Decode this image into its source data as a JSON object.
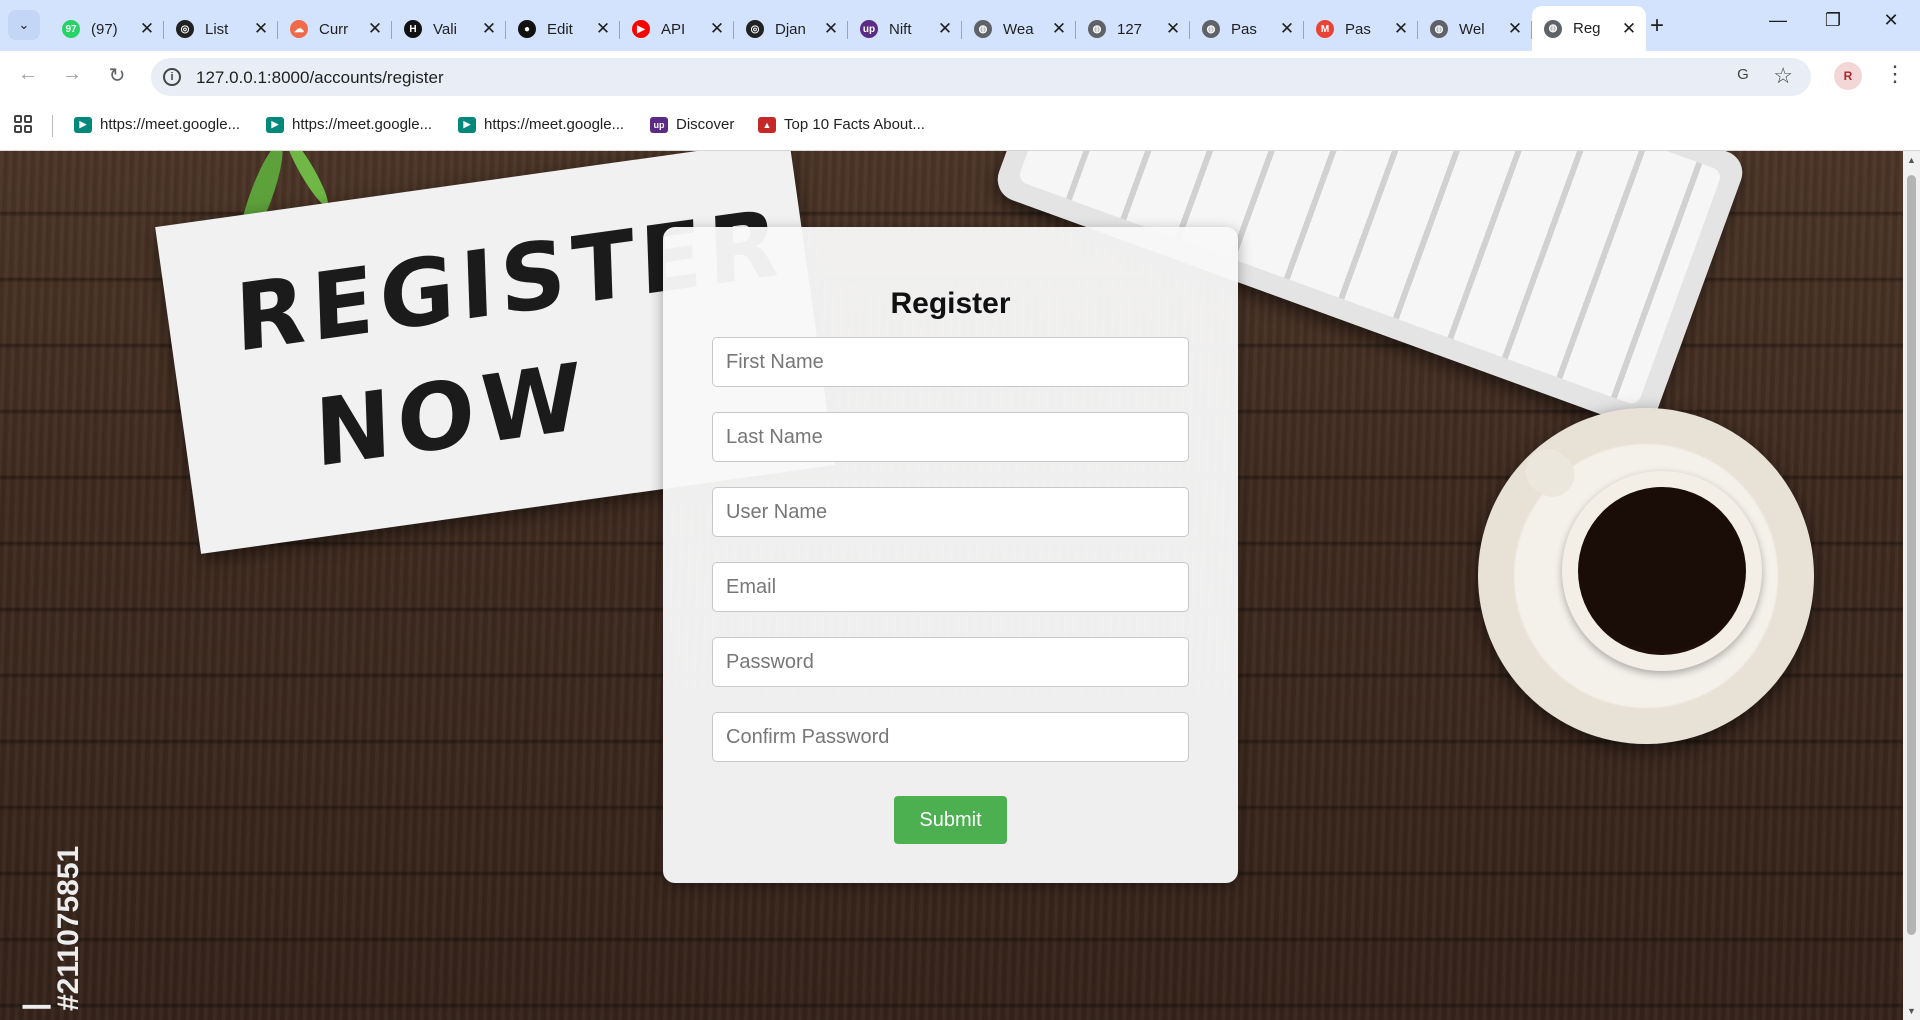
{
  "browser": {
    "tabs": [
      {
        "title": "(97)",
        "favicon": "whatsapp-icon",
        "color": "#25d366",
        "glyph": "97"
      },
      {
        "title": "List",
        "favicon": "openai-icon",
        "color": "#222222",
        "glyph": "◎"
      },
      {
        "title": "Curr",
        "favicon": "cloud-icon",
        "color": "#f06a4a",
        "glyph": "☁"
      },
      {
        "title": "Vali",
        "favicon": "hackerrank-icon",
        "color": "#111111",
        "glyph": "H"
      },
      {
        "title": "Edit",
        "favicon": "github-icon",
        "color": "#111111",
        "glyph": "●"
      },
      {
        "title": "API",
        "favicon": "youtube-icon",
        "color": "#ff0000",
        "glyph": "▶"
      },
      {
        "title": "Djan",
        "favicon": "openai-icon",
        "color": "#222222",
        "glyph": "◎"
      },
      {
        "title": "Nift",
        "favicon": "upwork-icon",
        "color": "#5b2a86",
        "glyph": "up"
      },
      {
        "title": "Wea",
        "favicon": "globe-icon",
        "color": "#5f6368",
        "glyph": "◍"
      },
      {
        "title": "127",
        "favicon": "globe-icon",
        "color": "#5f6368",
        "glyph": "◍"
      },
      {
        "title": "Pas",
        "favicon": "globe-icon",
        "color": "#5f6368",
        "glyph": "◍"
      },
      {
        "title": "Pas",
        "favicon": "gmail-icon",
        "color": "#ea4335",
        "glyph": "M"
      },
      {
        "title": "Wel",
        "favicon": "globe-icon",
        "color": "#5f6368",
        "glyph": "◍"
      },
      {
        "title": "Reg",
        "favicon": "globe-icon",
        "color": "#5f6368",
        "glyph": "◍",
        "active": true
      }
    ],
    "tab_close_glyph": "✕",
    "new_tab_glyph": "+",
    "window_controls": {
      "minimize": "—",
      "restore": "❐",
      "close": "✕"
    },
    "nav": {
      "back": "←",
      "forward": "→",
      "reload": "↻"
    },
    "url": "127.0.0.1:8000/accounts/register",
    "profile_initials": "R",
    "menu_glyph": "⋮",
    "star_glyph": "☆",
    "translate_glyph": "G",
    "bookmarks": [
      {
        "label": "https://meet.google...",
        "icon": "google-meet-icon",
        "color": "#00897b",
        "glyph": "▶"
      },
      {
        "label": "https://meet.google...",
        "icon": "google-meet-icon",
        "color": "#00897b",
        "glyph": "▶"
      },
      {
        "label": "https://meet.google...",
        "icon": "google-meet-icon",
        "color": "#00897b",
        "glyph": "▶"
      },
      {
        "label": "Discover",
        "icon": "upwork-icon",
        "color": "#5b2a86",
        "glyph": "up"
      },
      {
        "label": "Top 10 Facts About...",
        "icon": "flag-icon",
        "color": "#c62828",
        "glyph": "▲"
      }
    ]
  },
  "page": {
    "background_note_text": "REGISTER NOW",
    "watermark_text": "| #211075851",
    "form": {
      "title": "Register",
      "fields": [
        {
          "name": "first-name-input",
          "placeholder": "First Name",
          "type": "text"
        },
        {
          "name": "last-name-input",
          "placeholder": "Last Name",
          "type": "text"
        },
        {
          "name": "username-input",
          "placeholder": "User Name",
          "type": "text"
        },
        {
          "name": "email-input",
          "placeholder": "Email",
          "type": "email"
        },
        {
          "name": "password-input",
          "placeholder": "Password",
          "type": "password"
        },
        {
          "name": "confirm-password-input",
          "placeholder": "Confirm Password",
          "type": "password"
        }
      ],
      "submit_label": "Submit"
    }
  },
  "colors": {
    "submit_button": "#4caf50",
    "tabstrip": "#d3e3fd",
    "omnibox": "#e9eef6"
  }
}
